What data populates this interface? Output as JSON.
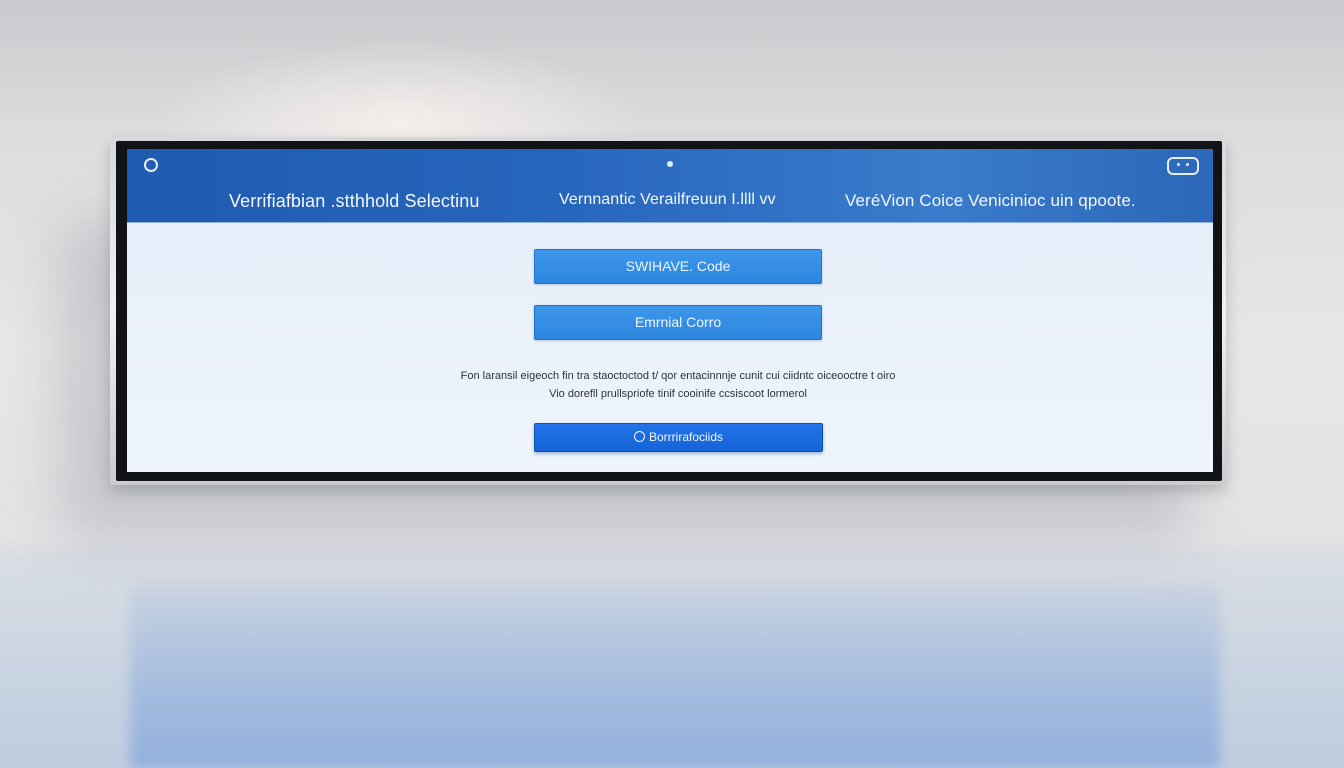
{
  "header": {
    "tabs": [
      {
        "label": "Verrifiafbian .stthhold Selectinu"
      },
      {
        "label": "Vernnantic Verailfreuun I.llll vv"
      },
      {
        "label": "VeréVion Coice Venicinioc uin qpoote."
      }
    ]
  },
  "main": {
    "share_button_label": "SWIHAVE. Code",
    "email_button_label": "Emrnial Corro",
    "description_line1": "Fon laransil eigeoch fin tra staoctoctod t/ qor entacinnnje cunit cui ciidntc oiceooctre t oiro",
    "description_line2": "Vio dorefll prullspriofe tinif cooinife ccsiscoot lormerol",
    "primary_button_label": "Borrrirafociids"
  },
  "colors": {
    "header_blue": "#2766bd",
    "button_blue": "#2d86de",
    "primary_blue": "#1663d8",
    "screen_bg": "#e9f1fa"
  },
  "icons": [
    "power-icon",
    "camera-dot-icon",
    "device-icon",
    "circle-icon"
  ]
}
